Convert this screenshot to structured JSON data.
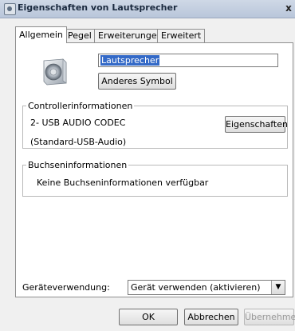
{
  "window": {
    "title": "Eigenschaften von Lautsprecher",
    "close_glyph": "x"
  },
  "tabs": [
    {
      "label": "Allgemein",
      "active": true
    },
    {
      "label": "Pegel",
      "active": false
    },
    {
      "label": "Erweiterungen",
      "active": false
    },
    {
      "label": "Erweitert",
      "active": false
    }
  ],
  "general": {
    "device_name_value": "Lautsprecher",
    "change_icon_label": "Anderes Symbol",
    "controller_group": {
      "title": "Controllerinformationen",
      "device": "2- USB AUDIO  CODEC",
      "driver": "(Standard-USB-Audio)",
      "properties_label": "Eigenschaften"
    },
    "jack_group": {
      "title": "Buchseninformationen",
      "text": "Keine Buchseninformationen verfügbar"
    },
    "usage": {
      "label": "Geräteverwendung:",
      "selected": "Gerät verwenden (aktivieren)"
    }
  },
  "footer": {
    "ok_label": "OK",
    "cancel_label": "Abbrechen",
    "apply_label": "Übernehmen"
  }
}
